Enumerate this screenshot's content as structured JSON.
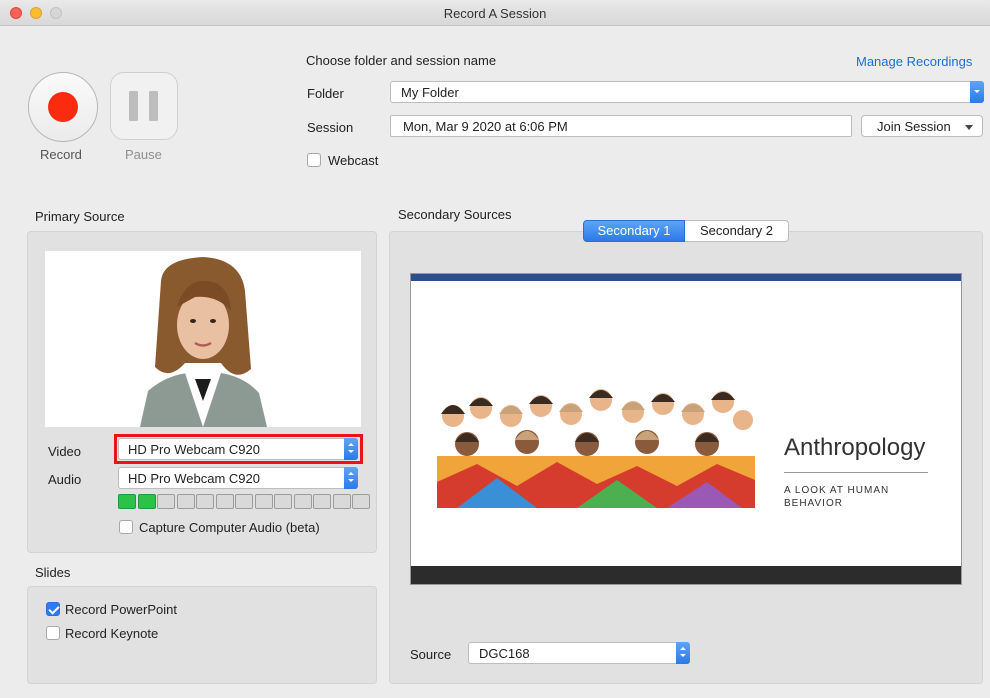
{
  "window": {
    "title": "Record A Session"
  },
  "controls": {
    "record_label": "Record",
    "pause_label": "Pause"
  },
  "session": {
    "heading": "Choose folder and session name",
    "manage_recordings": "Manage Recordings",
    "folder_label": "Folder",
    "folder_value": "My Folder",
    "session_label": "Session",
    "session_value": "Mon, Mar 9 2020 at 6:06 PM",
    "join_session": "Join Session",
    "webcast_label": "Webcast"
  },
  "primary": {
    "heading": "Primary Source",
    "video_label": "Video",
    "video_value": "HD Pro Webcam C920",
    "audio_label": "Audio",
    "audio_value": "HD Pro Webcam C920",
    "audio_level_segments": 13,
    "audio_level_active": 2,
    "capture_audio_label": "Capture Computer Audio (beta)"
  },
  "slides": {
    "heading": "Slides",
    "record_powerpoint": "Record PowerPoint",
    "record_keynote": "Record Keynote"
  },
  "secondary": {
    "heading": "Secondary Sources",
    "tabs": [
      "Secondary 1",
      "Secondary 2"
    ],
    "slide_title": "Anthropology",
    "slide_subtitle_line1": "A LOOK AT HUMAN",
    "slide_subtitle_line2": "BEHAVIOR",
    "source_label": "Source",
    "source_value": "DGC168"
  },
  "colors": {
    "accent": "#2c79e8",
    "record": "#fb2b10",
    "highlight": "#e8141c",
    "meter_on": "#2bc24a"
  }
}
